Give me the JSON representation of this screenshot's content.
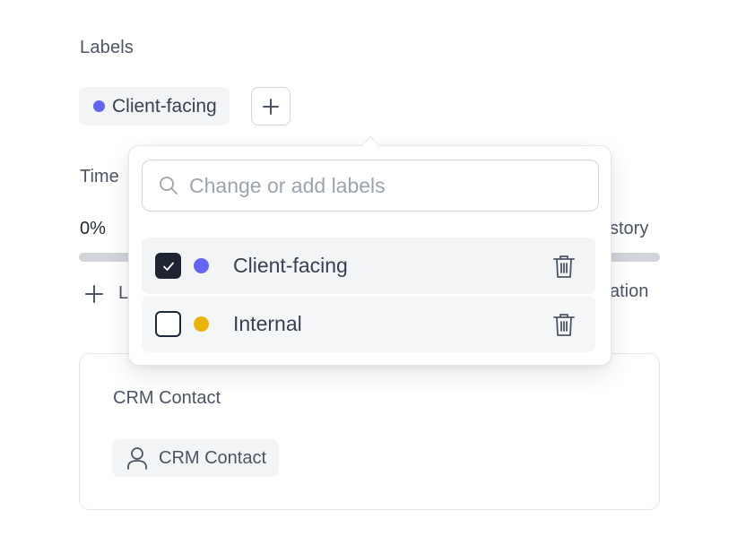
{
  "labels_section": {
    "title": "Labels",
    "applied_label": {
      "name": "Client-facing",
      "color": "#6366f1"
    },
    "add_button_icon": "plus-icon"
  },
  "time_section": {
    "title_visible": "Time",
    "percent": "0%",
    "right_link_visible": "story",
    "progress_value": 0.0,
    "add_row_label_visible": "L",
    "right_link2_visible": "ation"
  },
  "crm": {
    "title": "CRM Contact",
    "chip_label": "CRM Contact",
    "chip_icon": "person-icon"
  },
  "popover": {
    "search_placeholder": "Change or add labels",
    "search_value": "",
    "options": [
      {
        "name": "Client-facing",
        "color": "#6366f1",
        "checked": true,
        "delete_icon": "trash-icon"
      },
      {
        "name": "Internal",
        "color": "#eab308",
        "checked": false,
        "delete_icon": "trash-icon"
      }
    ]
  }
}
